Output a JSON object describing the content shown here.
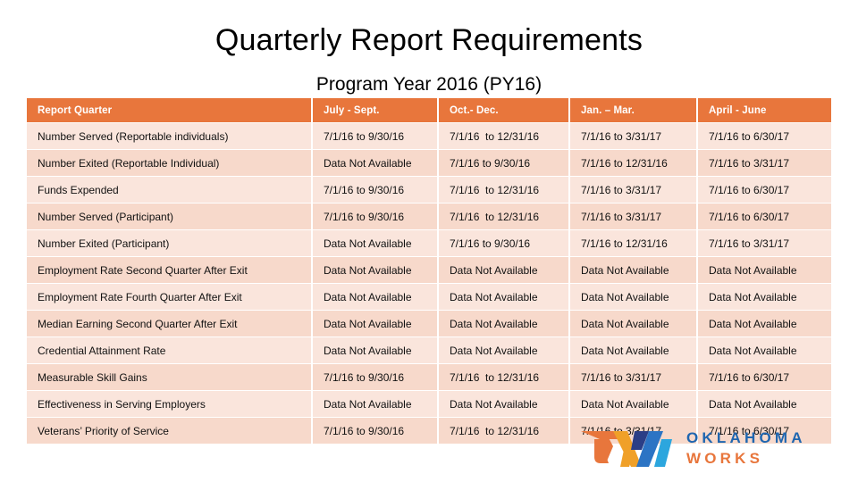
{
  "slide": {
    "title": "Quarterly Report Requirements",
    "subtitle": "Program Year 2016 (PY16)"
  },
  "table": {
    "headers": [
      "Report Quarter",
      "July - Sept.",
      "Oct.- Dec.",
      "Jan. – Mar.",
      "April - June"
    ],
    "rows": [
      {
        "label": "Number Served (Reportable individuals)",
        "values": [
          "7/1/16 to 9/30/16",
          "7/1/16  to 12/31/16",
          "7/1/16 to 3/31/17",
          "7/1/16 to 6/30/17"
        ]
      },
      {
        "label": "Number Exited (Reportable Individual)",
        "values": [
          "Data Not Available",
          "7/1/16 to 9/30/16",
          "7/1/16 to 12/31/16",
          "7/1/16 to 3/31/17"
        ]
      },
      {
        "label": "Funds Expended",
        "values": [
          "7/1/16 to 9/30/16",
          "7/1/16  to 12/31/16",
          "7/1/16 to 3/31/17",
          "7/1/16 to 6/30/17"
        ]
      },
      {
        "label": "Number Served (Participant)",
        "values": [
          "7/1/16 to 9/30/16",
          "7/1/16  to 12/31/16",
          "7/1/16 to 3/31/17",
          "7/1/16 to 6/30/17"
        ]
      },
      {
        "label": "Number Exited (Participant)",
        "values": [
          "Data Not Available",
          "7/1/16 to 9/30/16",
          "7/1/16 to 12/31/16",
          "7/1/16 to 3/31/17"
        ]
      },
      {
        "label": "Employment Rate Second Quarter After Exit",
        "values": [
          "Data Not Available",
          "Data Not Available",
          "Data Not Available",
          "Data Not Available"
        ]
      },
      {
        "label": "Employment Rate Fourth Quarter After Exit",
        "values": [
          "Data Not Available",
          "Data Not Available",
          "Data Not Available",
          "Data Not Available"
        ]
      },
      {
        "label": "Median Earning Second Quarter After Exit",
        "values": [
          "Data Not Available",
          "Data Not Available",
          "Data Not Available",
          "Data Not Available"
        ]
      },
      {
        "label": "Credential Attainment Rate",
        "values": [
          "Data Not Available",
          "Data Not Available",
          "Data Not Available",
          "Data Not Available"
        ]
      },
      {
        "label": "Measurable Skill Gains",
        "values": [
          "7/1/16 to 9/30/16",
          "7/1/16  to 12/31/16",
          "7/1/16 to 3/31/17",
          "7/1/16 to 6/30/17"
        ]
      },
      {
        "label": "Effectiveness in Serving Employers",
        "values": [
          "Data Not Available",
          "Data Not Available",
          "Data Not Available",
          "Data Not Available"
        ]
      },
      {
        "label": "Veterans’ Priority of Service",
        "values": [
          "7/1/16 to 9/30/16",
          "7/1/16  to 12/31/16",
          "7/1/16 to 3/31/17",
          "7/1/16 to 6/30/17"
        ]
      }
    ]
  },
  "logo": {
    "line1": "OKLAHOMA",
    "line2": "W O R K S",
    "line2_plain": "WORKS"
  },
  "colors": {
    "header_orange": "#E8763C",
    "row_light": "#FAE5DC",
    "row_dark": "#F7D9CB",
    "logo_blue": "#1F66B0",
    "logo_orange": "#E8763C",
    "logo_gold": "#F0A028",
    "logo_navy": "#2B3E86",
    "logo_cyan": "#2CA6DE"
  }
}
